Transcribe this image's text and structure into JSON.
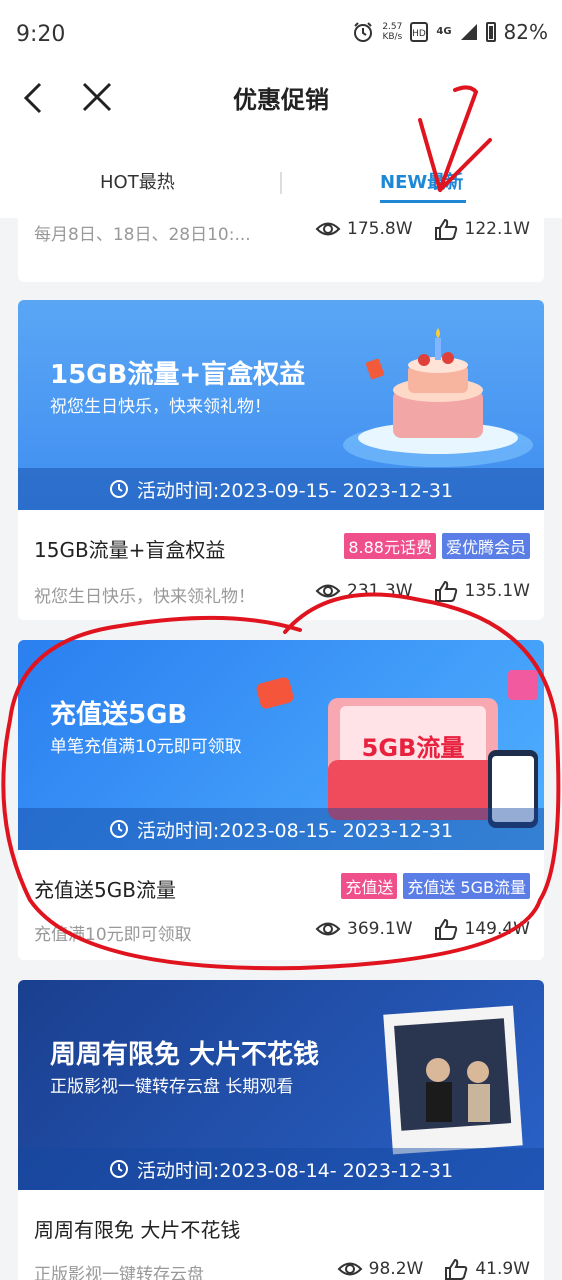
{
  "status_bar": {
    "time": "9:20",
    "speed_value": "2.57",
    "speed_unit": "KB/s",
    "network": "4G",
    "battery": "82%"
  },
  "header": {
    "title": "优惠促销"
  },
  "tabs": [
    {
      "label": "HOT最热"
    },
    {
      "label": "NEW最新"
    }
  ],
  "cards": [
    {
      "desc": "每月8日、18日、28日10:...",
      "views": "175.8W",
      "likes": "122.1W"
    },
    {
      "banner_title": "15GB流量+盲盒权益",
      "banner_subtitle": "祝您生日快乐，快来领礼物！",
      "period": "活动时间:2023-09-15- 2023-12-31",
      "title": "15GB流量+盲盒权益",
      "tags": [
        "8.88元话费",
        "爱优腾会员"
      ],
      "desc": "祝您生日快乐，快来领礼物！",
      "views": "231.3W",
      "likes": "135.1W"
    },
    {
      "banner_title": "充值送5GB",
      "banner_subtitle": "单笔充值满10元即可领取",
      "banner_graphic_text": "5GB流量",
      "period": "活动时间:2023-08-15- 2023-12-31",
      "title": "充值送5GB流量",
      "tags": [
        "充值送",
        "充值送 5GB流量"
      ],
      "desc": "充值满10元即可领取",
      "views": "369.1W",
      "likes": "149.4W"
    },
    {
      "banner_title": "周周有限免 大片不花钱",
      "banner_subtitle": "正版影视一键转存云盘 长期观看",
      "period": "活动时间:2023-08-14- 2023-12-31",
      "title": "周周有限免 大片不花钱",
      "desc": "正版影视一键转存云盘",
      "views": "98.2W",
      "likes": "41.9W"
    }
  ],
  "colors": {
    "accent": "#1e88d6",
    "tag_pink": "#ef4f8b",
    "tag_blue": "#5b7ee6",
    "annotation": "#e0141e"
  }
}
